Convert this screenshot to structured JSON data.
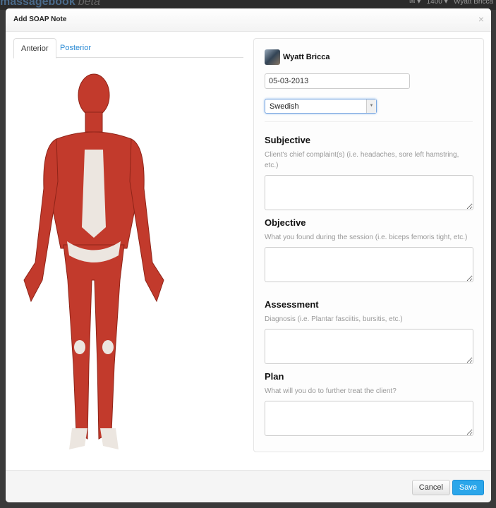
{
  "app": {
    "brand": "massagebook",
    "brand_suffix": "beta",
    "count": "1400",
    "user": "Wyatt Bricca"
  },
  "modal": {
    "title": "Add SOAP Note",
    "close": "×"
  },
  "tabs": [
    {
      "label": "Anterior",
      "active": true
    },
    {
      "label": "Posterior",
      "active": false
    }
  ],
  "form": {
    "client_name": "Wyatt Bricca",
    "date": "05-03-2013",
    "massage_type": "Swedish",
    "sections": [
      {
        "title": "Subjective",
        "hint": "Client's chief complaint(s) (i.e. headaches, sore left hamstring, etc.)",
        "value": ""
      },
      {
        "title": "Objective",
        "hint": "What you found during the session (i.e. biceps femoris tight, etc.)",
        "value": ""
      },
      {
        "title": "Assessment",
        "hint": "Diagnosis (i.e. Plantar fasciitis, bursitis, etc.)",
        "value": ""
      },
      {
        "title": "Plan",
        "hint": "What will you do to further treat the client?",
        "value": ""
      }
    ]
  },
  "footer": {
    "cancel": "Cancel",
    "save": "Save"
  },
  "colors": {
    "accent": "#2ba6ea",
    "link": "#2a8ad4",
    "muscle": "#c0392b"
  }
}
